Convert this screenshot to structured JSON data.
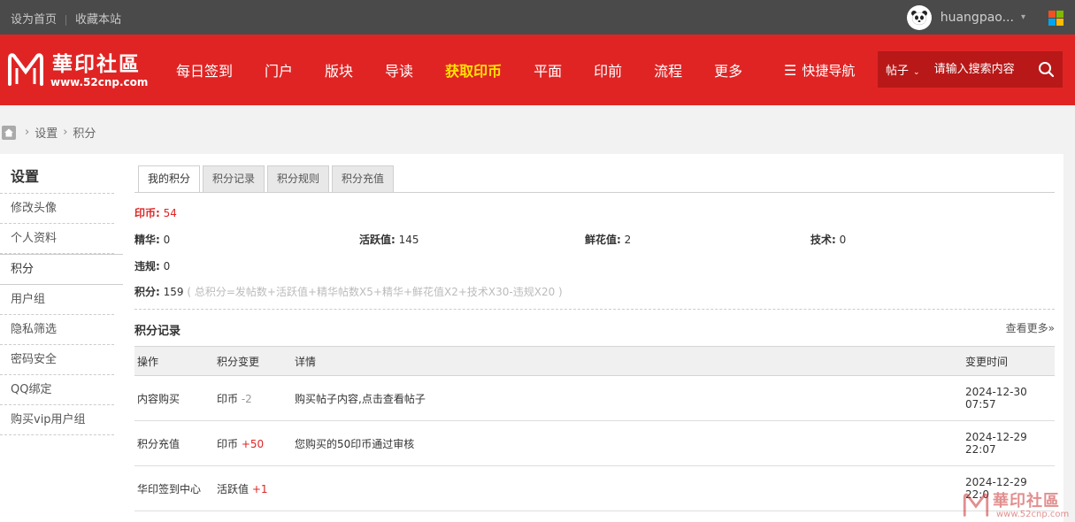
{
  "topbar": {
    "set_home": "设为首页",
    "bookmark": "收藏本站",
    "username": "huangpao...",
    "caret": "▾"
  },
  "colors": {
    "brand_red": "#e02424",
    "highlight_yellow": "#ffe400",
    "topbar_bg": "#4a4a4a",
    "win_red": "#f25022",
    "win_green": "#7fba00",
    "win_blue": "#00a4ef",
    "win_yellow": "#ffb900"
  },
  "logo": {
    "name": "華印社區",
    "url": "www.52cnp.com"
  },
  "nav": [
    {
      "label": "每日签到"
    },
    {
      "label": "门户"
    },
    {
      "label": "版块"
    },
    {
      "label": "导读"
    },
    {
      "label": "获取印币",
      "highlight": true
    },
    {
      "label": "平面"
    },
    {
      "label": "印前"
    },
    {
      "label": "流程"
    },
    {
      "label": "更多"
    }
  ],
  "quick_nav": {
    "label": "快捷导航",
    "icon": "list-icon"
  },
  "search": {
    "type": "帖子",
    "placeholder": "请输入搜索内容",
    "icon": "search-icon"
  },
  "breadcrumb": {
    "items": [
      "设置",
      "积分"
    ],
    "home_icon": "home-icon"
  },
  "sidebar": {
    "title": "设置",
    "items": [
      {
        "label": "修改头像"
      },
      {
        "label": "个人资料"
      },
      {
        "label": "积分",
        "active": true
      },
      {
        "label": "用户组"
      },
      {
        "label": "隐私筛选"
      },
      {
        "label": "密码安全"
      },
      {
        "label": "QQ绑定"
      },
      {
        "label": "购买vip用户组"
      }
    ]
  },
  "tabs": [
    {
      "label": "我的积分",
      "active": true
    },
    {
      "label": "积分记录"
    },
    {
      "label": "积分规则"
    },
    {
      "label": "积分充值"
    }
  ],
  "credits": {
    "yinbi_label": "印币:",
    "yinbi_value": "54",
    "jinghua_label": "精华:",
    "jinghua_value": "0",
    "huoyue_label": "活跃值:",
    "huoyue_value": "145",
    "xianhua_label": "鲜花值:",
    "xianhua_value": "2",
    "jishu_label": "技术:",
    "jishu_value": "0",
    "weigui_label": "违规:",
    "weigui_value": "0",
    "total_label": "积分:",
    "total_value": "159",
    "formula": "( 总积分=发帖数+活跃值+精华帖数X5+精华+鲜花值X2+技术X30-违规X20 )"
  },
  "records": {
    "title": "积分记录",
    "more": "查看更多»",
    "headers": [
      "操作",
      "积分变更",
      "详情",
      "变更时间"
    ],
    "rows": [
      {
        "op": "内容购买",
        "type": "印币",
        "change": "-2",
        "detail": "购买帖子内容,点击查看帖子",
        "date": "2024-12-30",
        "time": "07:57"
      },
      {
        "op": "积分充值",
        "type": "印币",
        "change": "+50",
        "detail": "您购买的50印币通过审核",
        "date": "2024-12-29",
        "time": "22:07"
      },
      {
        "op": "华印签到中心",
        "type": "活跃值",
        "change": "+1",
        "detail": "",
        "date": "2024-12-29",
        "time": "22:0"
      }
    ]
  },
  "watermark": {
    "name": "華印社區",
    "url": "www.52cnp.com"
  }
}
